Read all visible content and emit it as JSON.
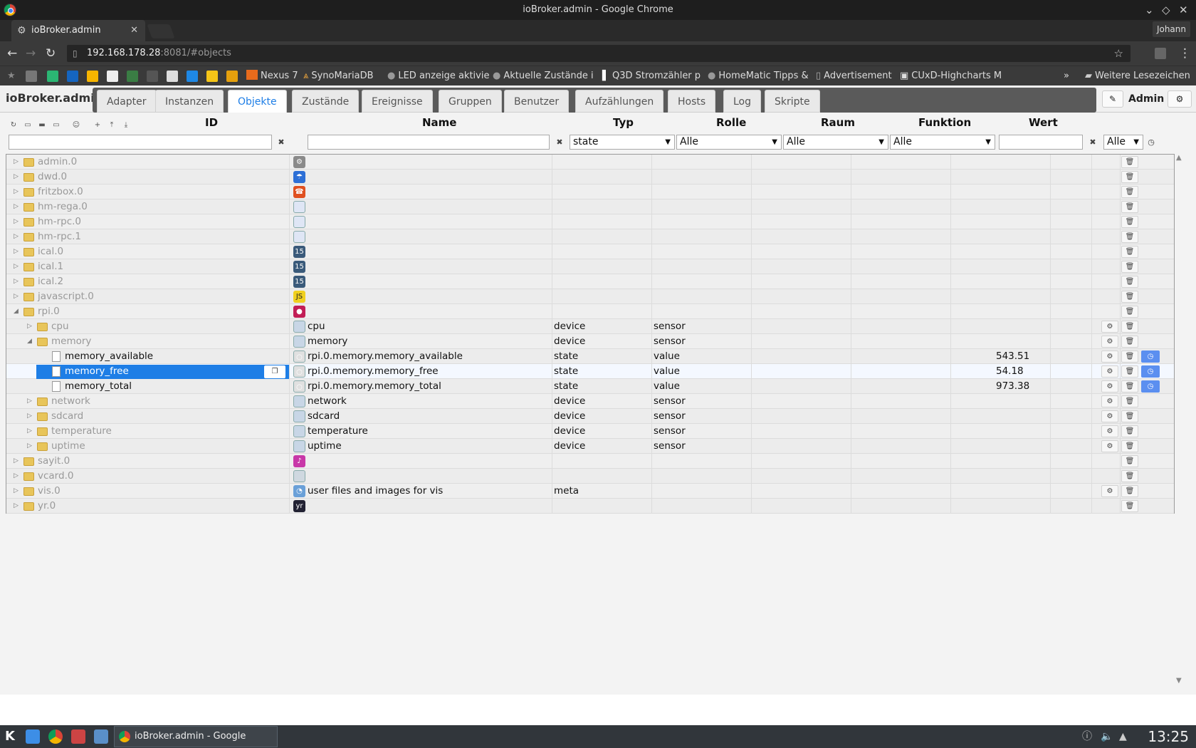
{
  "window": {
    "title": "ioBroker.admin - Google Chrome"
  },
  "browser": {
    "tab_label": "ioBroker.admin",
    "profile": "Johann",
    "url_host": "192.168.178.28",
    "url_rest": ":8081/#objects",
    "bookmarks": [
      "Nexus 7",
      "SynoMariaDB",
      "LED anzeige aktivie",
      "Aktuelle Zustände i",
      "Q3D Stromzähler p",
      "HomeMatic Tipps &",
      "Advertisement",
      "CUxD-Highcharts M"
    ],
    "more_bookmarks": "Weitere Lesezeichen"
  },
  "app": {
    "brand": "ioBroker.admin",
    "tabs": [
      "Adapter",
      "Instanzen",
      "Objekte",
      "Zustände",
      "Ereignisse",
      "Gruppen",
      "Benutzer",
      "Aufzählungen",
      "Hosts",
      "Log",
      "Skripte"
    ],
    "active_tab": "Objekte",
    "user": "Admin"
  },
  "columns": {
    "id": "ID",
    "name": "Name",
    "type": "Typ",
    "role": "Rolle",
    "room": "Raum",
    "function": "Funktion",
    "value": "Wert"
  },
  "filters": {
    "type": "state",
    "role": "Alle",
    "room": "Alle",
    "function": "Alle",
    "value_sel": "Alle"
  },
  "rows": [
    {
      "id": "admin.0",
      "level": 0,
      "twisty": "closed",
      "icon": "gear-icon",
      "name": "",
      "type": "",
      "role": "",
      "value": ""
    },
    {
      "id": "dwd.0",
      "level": 0,
      "twisty": "closed",
      "icon": "weather-icon",
      "name": "",
      "type": "",
      "role": "",
      "value": ""
    },
    {
      "id": "fritzbox.0",
      "level": 0,
      "twisty": "closed",
      "icon": "phone-icon",
      "name": "",
      "type": "",
      "role": "",
      "value": ""
    },
    {
      "id": "hm-rega.0",
      "level": 0,
      "twisty": "closed",
      "icon": "document-icon",
      "name": "",
      "type": "",
      "role": "",
      "value": ""
    },
    {
      "id": "hm-rpc.0",
      "level": 0,
      "twisty": "closed",
      "icon": "document-icon",
      "name": "",
      "type": "",
      "role": "",
      "value": ""
    },
    {
      "id": "hm-rpc.1",
      "level": 0,
      "twisty": "closed",
      "icon": "document-icon",
      "name": "",
      "type": "",
      "role": "",
      "value": ""
    },
    {
      "id": "ical.0",
      "level": 0,
      "twisty": "closed",
      "icon": "calendar-icon",
      "name": "",
      "type": "",
      "role": "",
      "value": ""
    },
    {
      "id": "ical.1",
      "level": 0,
      "twisty": "closed",
      "icon": "calendar-icon",
      "name": "",
      "type": "",
      "role": "",
      "value": ""
    },
    {
      "id": "ical.2",
      "level": 0,
      "twisty": "closed",
      "icon": "calendar-icon",
      "name": "",
      "type": "",
      "role": "",
      "value": ""
    },
    {
      "id": "javascript.0",
      "level": 0,
      "twisty": "closed",
      "icon": "javascript-icon",
      "name": "",
      "type": "",
      "role": "",
      "value": ""
    },
    {
      "id": "rpi.0",
      "level": 0,
      "twisty": "open",
      "icon": "raspberry-icon",
      "name": "",
      "type": "",
      "role": "",
      "value": ""
    },
    {
      "id": "cpu",
      "level": 1,
      "twisty": "closed",
      "icon": "device-icon",
      "name": "cpu",
      "type": "device",
      "role": "sensor",
      "value": "",
      "gear": true
    },
    {
      "id": "memory",
      "level": 1,
      "twisty": "open",
      "icon": "device-icon",
      "name": "memory",
      "type": "device",
      "role": "sensor",
      "value": "",
      "gear": true
    },
    {
      "id": "memory_available",
      "level": 2,
      "leaf": true,
      "icon": "state-icon",
      "name": "rpi.0.memory.memory_available",
      "type": "state",
      "role": "value",
      "value": "543.51",
      "gear": true,
      "hist": true
    },
    {
      "id": "memory_free",
      "level": 2,
      "leaf": true,
      "selected": true,
      "icon": "state-icon",
      "name": "rpi.0.memory.memory_free",
      "type": "state",
      "role": "value",
      "value": "54.18",
      "gear": true,
      "hist": true
    },
    {
      "id": "memory_total",
      "level": 2,
      "leaf": true,
      "icon": "state-icon",
      "name": "rpi.0.memory.memory_total",
      "type": "state",
      "role": "value",
      "value": "973.38",
      "gear": true,
      "hist": true
    },
    {
      "id": "network",
      "level": 1,
      "twisty": "closed",
      "icon": "device-icon",
      "name": "network",
      "type": "device",
      "role": "sensor",
      "value": "",
      "gear": true
    },
    {
      "id": "sdcard",
      "level": 1,
      "twisty": "closed",
      "icon": "device-icon",
      "name": "sdcard",
      "type": "device",
      "role": "sensor",
      "value": "",
      "gear": true
    },
    {
      "id": "temperature",
      "level": 1,
      "twisty": "closed",
      "icon": "device-icon",
      "name": "temperature",
      "type": "device",
      "role": "sensor",
      "value": "",
      "gear": true
    },
    {
      "id": "uptime",
      "level": 1,
      "twisty": "closed",
      "icon": "device-icon",
      "name": "uptime",
      "type": "device",
      "role": "sensor",
      "value": "",
      "gear": true
    },
    {
      "id": "sayit.0",
      "level": 0,
      "twisty": "closed",
      "icon": "speech-icon",
      "name": "",
      "type": "",
      "role": "",
      "value": ""
    },
    {
      "id": "vcard.0",
      "level": 0,
      "twisty": "closed",
      "icon": "contact-card-icon",
      "name": "",
      "type": "",
      "role": "",
      "value": ""
    },
    {
      "id": "vis.0",
      "level": 0,
      "twisty": "closed",
      "icon": "vis-icon",
      "name": "user files and images for vis",
      "type": "meta",
      "role": "",
      "value": "",
      "gear": true
    },
    {
      "id": "yr.0",
      "level": 0,
      "twisty": "closed",
      "icon": "yr-icon",
      "name": "",
      "type": "",
      "role": "",
      "value": ""
    }
  ],
  "taskbar": {
    "task_label": "ioBroker.admin - Google Chrome",
    "clock": "13:25"
  },
  "colors": {
    "accent": "#1e7ee6",
    "history": "#5b8ff0",
    "folder": "#e8c55a"
  }
}
